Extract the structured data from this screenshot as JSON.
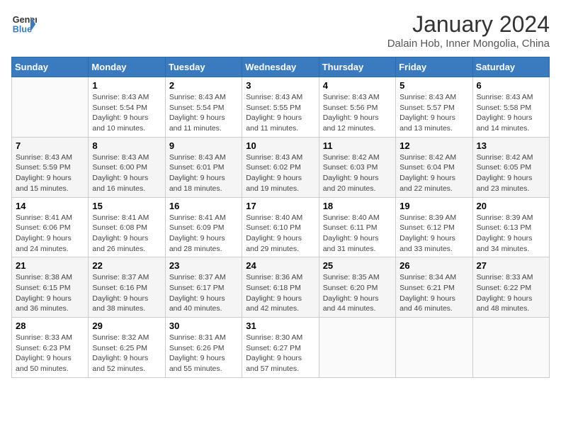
{
  "logo": {
    "line1": "General",
    "line2": "Blue"
  },
  "title": "January 2024",
  "subtitle": "Dalain Hob, Inner Mongolia, China",
  "days_of_week": [
    "Sunday",
    "Monday",
    "Tuesday",
    "Wednesday",
    "Thursday",
    "Friday",
    "Saturday"
  ],
  "weeks": [
    [
      {
        "day": "",
        "info": ""
      },
      {
        "day": "1",
        "info": "Sunrise: 8:43 AM\nSunset: 5:54 PM\nDaylight: 9 hours\nand 10 minutes."
      },
      {
        "day": "2",
        "info": "Sunrise: 8:43 AM\nSunset: 5:54 PM\nDaylight: 9 hours\nand 11 minutes."
      },
      {
        "day": "3",
        "info": "Sunrise: 8:43 AM\nSunset: 5:55 PM\nDaylight: 9 hours\nand 11 minutes."
      },
      {
        "day": "4",
        "info": "Sunrise: 8:43 AM\nSunset: 5:56 PM\nDaylight: 9 hours\nand 12 minutes."
      },
      {
        "day": "5",
        "info": "Sunrise: 8:43 AM\nSunset: 5:57 PM\nDaylight: 9 hours\nand 13 minutes."
      },
      {
        "day": "6",
        "info": "Sunrise: 8:43 AM\nSunset: 5:58 PM\nDaylight: 9 hours\nand 14 minutes."
      }
    ],
    [
      {
        "day": "7",
        "info": "Sunrise: 8:43 AM\nSunset: 5:59 PM\nDaylight: 9 hours\nand 15 minutes."
      },
      {
        "day": "8",
        "info": "Sunrise: 8:43 AM\nSunset: 6:00 PM\nDaylight: 9 hours\nand 16 minutes."
      },
      {
        "day": "9",
        "info": "Sunrise: 8:43 AM\nSunset: 6:01 PM\nDaylight: 9 hours\nand 18 minutes."
      },
      {
        "day": "10",
        "info": "Sunrise: 8:43 AM\nSunset: 6:02 PM\nDaylight: 9 hours\nand 19 minutes."
      },
      {
        "day": "11",
        "info": "Sunrise: 8:42 AM\nSunset: 6:03 PM\nDaylight: 9 hours\nand 20 minutes."
      },
      {
        "day": "12",
        "info": "Sunrise: 8:42 AM\nSunset: 6:04 PM\nDaylight: 9 hours\nand 22 minutes."
      },
      {
        "day": "13",
        "info": "Sunrise: 8:42 AM\nSunset: 6:05 PM\nDaylight: 9 hours\nand 23 minutes."
      }
    ],
    [
      {
        "day": "14",
        "info": "Sunrise: 8:41 AM\nSunset: 6:06 PM\nDaylight: 9 hours\nand 24 minutes."
      },
      {
        "day": "15",
        "info": "Sunrise: 8:41 AM\nSunset: 6:08 PM\nDaylight: 9 hours\nand 26 minutes."
      },
      {
        "day": "16",
        "info": "Sunrise: 8:41 AM\nSunset: 6:09 PM\nDaylight: 9 hours\nand 28 minutes."
      },
      {
        "day": "17",
        "info": "Sunrise: 8:40 AM\nSunset: 6:10 PM\nDaylight: 9 hours\nand 29 minutes."
      },
      {
        "day": "18",
        "info": "Sunrise: 8:40 AM\nSunset: 6:11 PM\nDaylight: 9 hours\nand 31 minutes."
      },
      {
        "day": "19",
        "info": "Sunrise: 8:39 AM\nSunset: 6:12 PM\nDaylight: 9 hours\nand 33 minutes."
      },
      {
        "day": "20",
        "info": "Sunrise: 8:39 AM\nSunset: 6:13 PM\nDaylight: 9 hours\nand 34 minutes."
      }
    ],
    [
      {
        "day": "21",
        "info": "Sunrise: 8:38 AM\nSunset: 6:15 PM\nDaylight: 9 hours\nand 36 minutes."
      },
      {
        "day": "22",
        "info": "Sunrise: 8:37 AM\nSunset: 6:16 PM\nDaylight: 9 hours\nand 38 minutes."
      },
      {
        "day": "23",
        "info": "Sunrise: 8:37 AM\nSunset: 6:17 PM\nDaylight: 9 hours\nand 40 minutes."
      },
      {
        "day": "24",
        "info": "Sunrise: 8:36 AM\nSunset: 6:18 PM\nDaylight: 9 hours\nand 42 minutes."
      },
      {
        "day": "25",
        "info": "Sunrise: 8:35 AM\nSunset: 6:20 PM\nDaylight: 9 hours\nand 44 minutes."
      },
      {
        "day": "26",
        "info": "Sunrise: 8:34 AM\nSunset: 6:21 PM\nDaylight: 9 hours\nand 46 minutes."
      },
      {
        "day": "27",
        "info": "Sunrise: 8:33 AM\nSunset: 6:22 PM\nDaylight: 9 hours\nand 48 minutes."
      }
    ],
    [
      {
        "day": "28",
        "info": "Sunrise: 8:33 AM\nSunset: 6:23 PM\nDaylight: 9 hours\nand 50 minutes."
      },
      {
        "day": "29",
        "info": "Sunrise: 8:32 AM\nSunset: 6:25 PM\nDaylight: 9 hours\nand 52 minutes."
      },
      {
        "day": "30",
        "info": "Sunrise: 8:31 AM\nSunset: 6:26 PM\nDaylight: 9 hours\nand 55 minutes."
      },
      {
        "day": "31",
        "info": "Sunrise: 8:30 AM\nSunset: 6:27 PM\nDaylight: 9 hours\nand 57 minutes."
      },
      {
        "day": "",
        "info": ""
      },
      {
        "day": "",
        "info": ""
      },
      {
        "day": "",
        "info": ""
      }
    ]
  ]
}
